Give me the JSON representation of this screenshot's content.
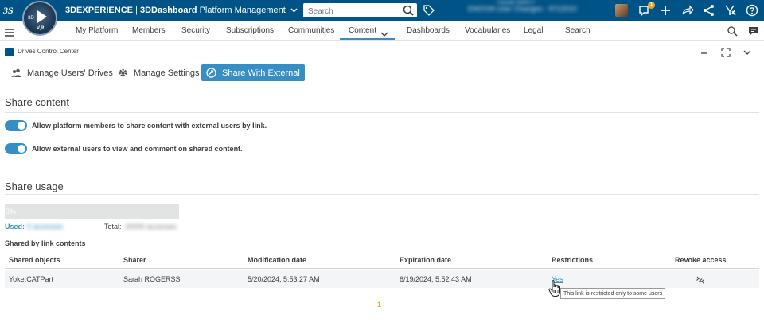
{
  "topbar": {
    "brand_prefix": "3DEXPERIENCE",
    "brand_app": "3DDashboard",
    "brand_context": "Platform Management",
    "search_placeholder": "Search",
    "user_name": "Claude WAFLY",
    "user_context": "ENOVIA User Changes - 9712010",
    "notification_count": "1",
    "compass_3d": "3D",
    "compass_vr": "V,R"
  },
  "nav": {
    "items": [
      "My Platform",
      "Members",
      "Security",
      "Subscriptions",
      "Communities",
      "Content",
      "Dashboards",
      "Vocabularies",
      "Legal",
      "Search"
    ],
    "active": "Content"
  },
  "widget": {
    "title": "Drives Control Center"
  },
  "tabs": [
    {
      "label": "Manage Users' Drives",
      "icon": "users-icon"
    },
    {
      "label": "Manage Settings",
      "icon": "gear-icon"
    },
    {
      "label": "Share With External",
      "icon": "share-icon",
      "active": true
    }
  ],
  "share_content": {
    "title": "Share content",
    "toggles": [
      {
        "label": "Allow platform members to share content with external users by link.",
        "on": true
      },
      {
        "label": "Allow external users to view and comment on shared content.",
        "on": true
      }
    ]
  },
  "share_usage": {
    "title": "Share usage",
    "progress_label": "0%",
    "progress_value": 0,
    "used_label": "Used:",
    "used_value": "0 accesses",
    "total_label": "Total:",
    "total_value": "20000 accesses",
    "shared_by_link_label": "Shared by link contents"
  },
  "table": {
    "headers": [
      "Shared objects",
      "Sharer",
      "Modification date",
      "Expiration date",
      "Restrictions",
      "Revoke access"
    ],
    "rows": [
      {
        "object": "Yoke.CATPart",
        "sharer": "Sarah ROGERSS",
        "modified": "5/20/2024, 5:53:27 AM",
        "expires": "6/19/2024, 5:52:43 AM",
        "restrictions": "Yes"
      }
    ],
    "tooltip": "This link is restricted only to some users",
    "page": "1"
  },
  "colors": {
    "topbar": "#005386",
    "accent": "#368ec4",
    "pagination": "#f2a31b"
  }
}
